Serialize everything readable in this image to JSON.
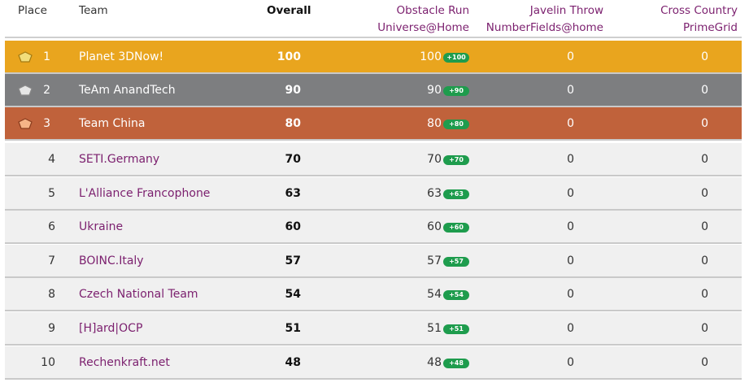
{
  "header": {
    "place": "Place",
    "team": "Team",
    "overall": "Overall",
    "obstacle_run": "Obstacle Run",
    "obstacle_run_project": "Universe@Home",
    "javelin_throw": "Javelin Throw",
    "javelin_throw_project": "NumberFields@home",
    "cross_country": "Cross Country",
    "cross_country_project": "PrimeGrid"
  },
  "colors": {
    "gold": "#e9a51e",
    "silver": "#7d7e80",
    "bronze": "#c0623b",
    "link": "#7b1f6e",
    "badge": "#1e9c4d"
  },
  "rows": [
    {
      "place": "1",
      "team": "Planet 3DNow!",
      "overall": "100",
      "obstacle": "100",
      "badge": "+100",
      "javelin": "0",
      "cross": "0",
      "medal": "gold"
    },
    {
      "place": "2",
      "team": "TeAm AnandTech",
      "overall": "90",
      "obstacle": "90",
      "badge": "+90",
      "javelin": "0",
      "cross": "0",
      "medal": "silver"
    },
    {
      "place": "3",
      "team": "Team China",
      "overall": "80",
      "obstacle": "80",
      "badge": "+80",
      "javelin": "0",
      "cross": "0",
      "medal": "bronze"
    },
    {
      "place": "4",
      "team": "SETI.Germany",
      "overall": "70",
      "obstacle": "70",
      "badge": "+70",
      "javelin": "0",
      "cross": "0"
    },
    {
      "place": "5",
      "team": "L'Alliance Francophone",
      "overall": "63",
      "obstacle": "63",
      "badge": "+63",
      "javelin": "0",
      "cross": "0"
    },
    {
      "place": "6",
      "team": "Ukraine",
      "overall": "60",
      "obstacle": "60",
      "badge": "+60",
      "javelin": "0",
      "cross": "0"
    },
    {
      "place": "7",
      "team": "BOINC.Italy",
      "overall": "57",
      "obstacle": "57",
      "badge": "+57",
      "javelin": "0",
      "cross": "0"
    },
    {
      "place": "8",
      "team": "Czech National Team",
      "overall": "54",
      "obstacle": "54",
      "badge": "+54",
      "javelin": "0",
      "cross": "0"
    },
    {
      "place": "9",
      "team": "[H]ard|OCP",
      "overall": "51",
      "obstacle": "51",
      "badge": "+51",
      "javelin": "0",
      "cross": "0"
    },
    {
      "place": "10",
      "team": "Rechenkraft.net",
      "overall": "48",
      "obstacle": "48",
      "badge": "+48",
      "javelin": "0",
      "cross": "0"
    }
  ]
}
